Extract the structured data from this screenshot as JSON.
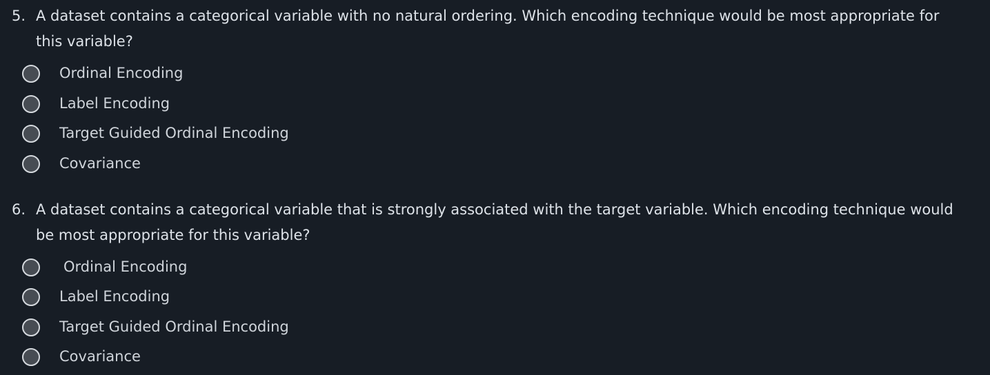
{
  "questions": [
    {
      "number": "5.",
      "text_line1": "A dataset contains a categorical variable with no natural ordering. Which encoding technique would be most appropriate for",
      "text_line2": "this variable?",
      "options": [
        {
          "label": "Ordinal Encoding",
          "selected": false
        },
        {
          "label": "Label Encoding",
          "selected": false
        },
        {
          "label": "Target Guided Ordinal Encoding",
          "selected": false
        },
        {
          "label": "Covariance",
          "selected": false
        }
      ]
    },
    {
      "number": "6.",
      "text_line1": "A dataset contains a categorical variable that is strongly associated with the target variable. Which encoding technique would",
      "text_line2": "be most appropriate for this variable?",
      "options": [
        {
          "label": "Ordinal Encoding",
          "selected": false
        },
        {
          "label": "Label Encoding",
          "selected": false
        },
        {
          "label": "Target Guided Ordinal Encoding",
          "selected": false
        },
        {
          "label": "Covariance",
          "selected": false
        }
      ]
    }
  ],
  "colors": {
    "background": "#171d25",
    "text": "#dde2e8",
    "radio_fill": "#474c53",
    "radio_border": "#d5d9de"
  }
}
